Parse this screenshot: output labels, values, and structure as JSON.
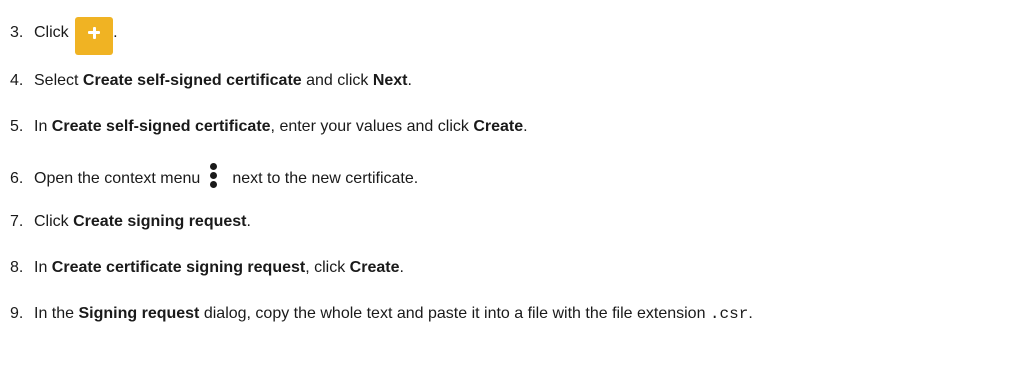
{
  "steps": [
    {
      "num": "3.",
      "a": "Click",
      "b": "."
    },
    {
      "num": "4.",
      "a": "Select ",
      "b": "Create self-signed certificate",
      "c": " and click ",
      "d": "Next",
      "e": "."
    },
    {
      "num": "5.",
      "a": "In ",
      "b": "Create self-signed certificate",
      "c": ", enter your values and click ",
      "d": "Create",
      "e": "."
    },
    {
      "num": "6.",
      "a": "Open the context menu",
      "b": "next to the new certificate."
    },
    {
      "num": "7.",
      "a": "Click ",
      "b": "Create signing request",
      "c": "."
    },
    {
      "num": "8.",
      "a": "In ",
      "b": "Create certificate signing request",
      "c": ", click ",
      "d": "Create",
      "e": "."
    },
    {
      "num": "9.",
      "a": "In the ",
      "b": "Signing request",
      "c": " dialog, copy the whole text and paste it into a file with the file extension ",
      "d": ".csr",
      "e": "."
    }
  ],
  "colors": {
    "accent": "#f0b323",
    "text": "#1a1a1a"
  }
}
